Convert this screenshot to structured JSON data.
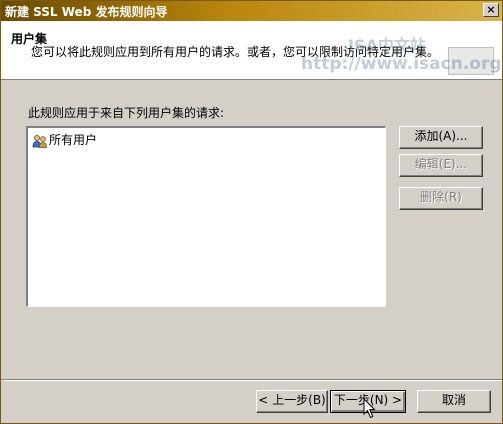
{
  "window": {
    "title": "新建 SSL Web 发布规则向导",
    "close_glyph": "×"
  },
  "watermark": {
    "line1": "ISA中文站",
    "line2": "http://www.isacn.org"
  },
  "header": {
    "title": "用户集",
    "description": "您可以将此规则应用到所有用户的请求。或者，您可以限制访问特定用户集。"
  },
  "body": {
    "list_label": "此规则应用于来自下列用户集的请求:",
    "user_sets": [
      {
        "label": "所有用户",
        "icon": "users-icon"
      }
    ]
  },
  "side_buttons": {
    "add": "添加(A)...",
    "edit": "编辑(E)...",
    "remove": "删除(R)"
  },
  "footer_buttons": {
    "back": "< 上一步(B)",
    "next": "下一步(N) >",
    "cancel": "取消"
  }
}
